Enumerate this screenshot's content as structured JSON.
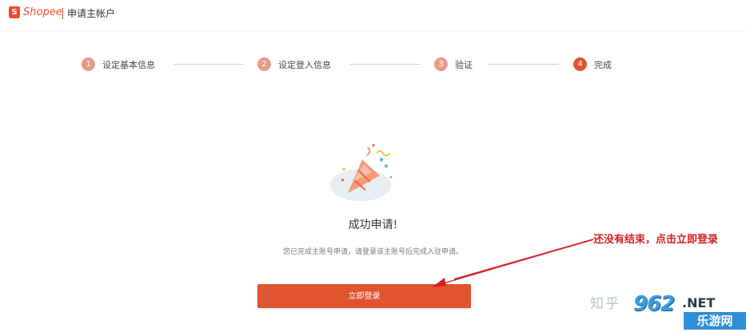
{
  "header": {
    "logo_text": "Shopee",
    "logo_glyph": "S",
    "title": "申请主帐户"
  },
  "steps": [
    {
      "num": "1",
      "label": "设定基本信息"
    },
    {
      "num": "2",
      "label": "设定登入信息"
    },
    {
      "num": "3",
      "label": "验证"
    },
    {
      "num": "4",
      "label": "完成"
    }
  ],
  "steps_current": 4,
  "main": {
    "illustration": "party-popper-icon",
    "title": "成功申请!",
    "description": "您已完成主账号申请，请登录该主账号后完成入驻申请。",
    "login_button": "立即登录"
  },
  "annotation": {
    "text": "还没有结束，点击立即登录",
    "color": "#d42020"
  },
  "watermark": {
    "zhihu": "知乎",
    "brand_number": "962",
    "brand_suffix": ".NET",
    "site_name": "乐游网"
  },
  "colors": {
    "accent": "#ee4d2d",
    "button": "#e0542f",
    "step_inactive": "#e79a86"
  }
}
